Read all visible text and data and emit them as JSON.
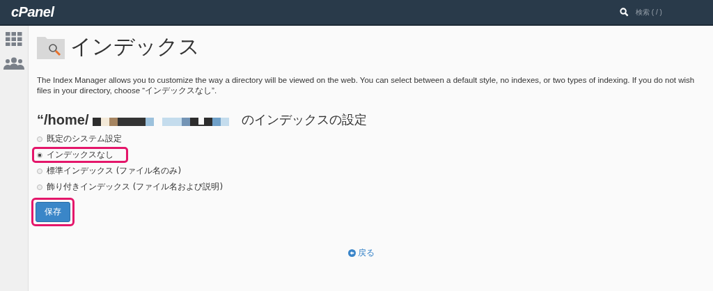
{
  "header": {
    "logo": "cPanel",
    "search": {
      "placeholder": "検索 ( / )"
    }
  },
  "page": {
    "title": "インデックス",
    "description": "The Index Manager allows you to customize the way a directory will be viewed on the web. You can select between a default style, no indexes, or two types of indexing. If you do not wish\nfiles in your directory, choose “インデックスなし”.",
    "heading_prefix": "“/home/",
    "heading_suffix": "のインデックスの設定",
    "options": [
      {
        "label": "既定のシステム設定",
        "selected": false,
        "highlighted": false
      },
      {
        "label": "インデックスなし",
        "selected": true,
        "highlighted": true
      },
      {
        "label": "標準インデックス (ファイル名のみ)",
        "selected": false,
        "highlighted": false
      },
      {
        "label": "飾り付きインデックス (ファイル名および説明)",
        "selected": false,
        "highlighted": false
      }
    ],
    "save_button": {
      "label": "保存",
      "highlighted": true
    },
    "back_link": "戻る"
  }
}
